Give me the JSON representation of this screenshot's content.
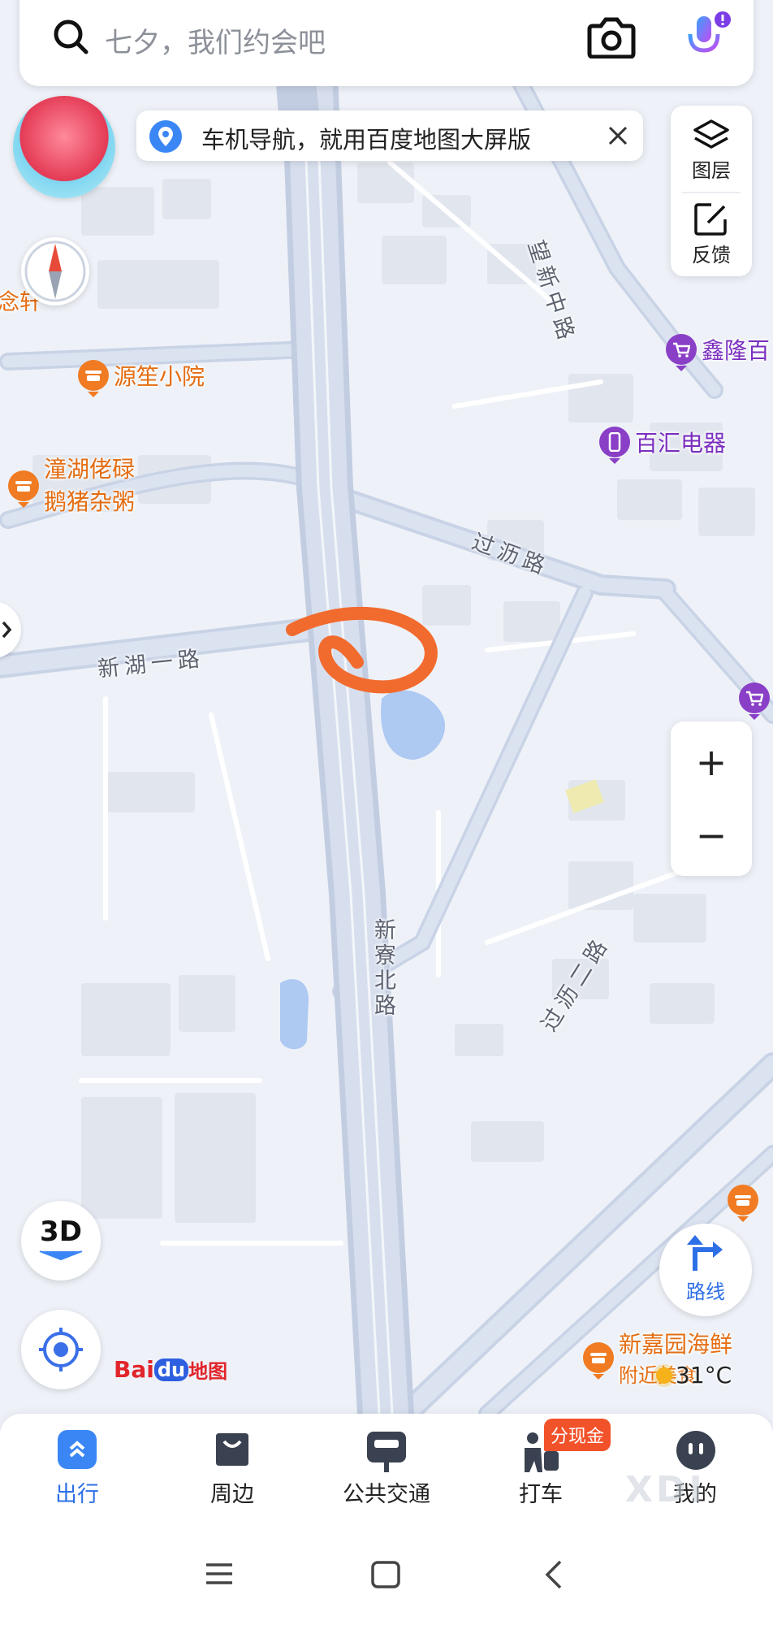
{
  "search": {
    "placeholder": "七夕，我们约会吧"
  },
  "banner": {
    "text": "车机导航，就用百度地图大屏版"
  },
  "right_tools": {
    "layers_label": "图层",
    "feedback_label": "反馈"
  },
  "map": {
    "roads": [
      "望新中路",
      "过沥路",
      "新湖一路",
      "新寮北路",
      "过沥二路"
    ],
    "pois": [
      {
        "name": "源笙小院",
        "color": "#f07b22"
      },
      {
        "name": "潼湖佬碌",
        "color": "#f07b22"
      },
      {
        "name": "鹅猪杂粥",
        "color": "#f07b22"
      },
      {
        "name": "百汇电器",
        "color": "#8a3fc7"
      },
      {
        "name": "鑫隆百",
        "color": "#8a3fc7"
      },
      {
        "name": "新嘉园海鲜",
        "color": "#f07b22"
      },
      {
        "name": "附近美食",
        "color": "#f07b22"
      }
    ],
    "partial_label": "相念轩",
    "weather": "31°C"
  },
  "controls": {
    "three_d": "3D",
    "route_label": "路线",
    "zoom_in": "+",
    "zoom_out": "−"
  },
  "logo": {
    "text_left": "Bai",
    "text_mid": "du",
    "text_right": "地图"
  },
  "bottom_nav": [
    {
      "label": "出行",
      "active": true
    },
    {
      "label": "周边",
      "active": false
    },
    {
      "label": "公共交通",
      "active": false
    },
    {
      "label": "打车",
      "active": false,
      "badge": "分现金"
    },
    {
      "label": "我的",
      "active": false
    }
  ],
  "watermark": "XDI",
  "colors": {
    "accent": "#3a6fe8",
    "poi_orange": "#f07b22",
    "poi_purple": "#8a3fc7",
    "annotation": "#f26b2e"
  }
}
